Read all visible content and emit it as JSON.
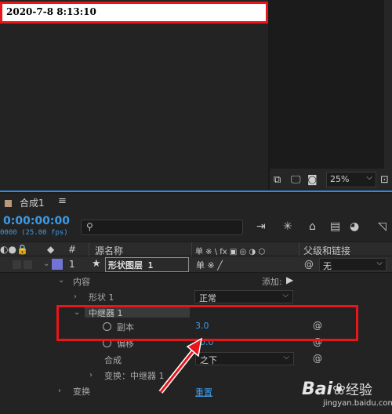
{
  "timestamp": "2020-7-8 8:13:10",
  "viewer_tools": {
    "zoom": "25%"
  },
  "timeline": {
    "tab_label": "合成1",
    "menu_icon": "≡",
    "timecode": "0:00:00:00",
    "fps_text": "0000 (25.00 fps)",
    "search_placeholder": "⚲"
  },
  "columns": {
    "num": "#",
    "source_name": "源名称",
    "switches": "单 ※ \\ fx ▣ ◎ ◑ ⬡",
    "parent": "父级和链接"
  },
  "layer": {
    "number": "1",
    "name": "形状图层 1",
    "parent_value": "无",
    "label_color": "#6f74d6"
  },
  "props": {
    "contents": "内容",
    "add_label": "添加:",
    "shape": "形状 1",
    "shape_mode": "正常",
    "repeater": "中继器 1",
    "copies": "副本",
    "copies_value": "3.0",
    "offset": "偏移",
    "offset_value": "0.0",
    "composite": "合成",
    "composite_value": "之下",
    "transform_repeater": "变换：中继器 1",
    "transform": "变换",
    "reset": "重置"
  },
  "watermark": {
    "brand": "Bai",
    "brand2": "经验",
    "url": "jingyan.baidu.com"
  }
}
